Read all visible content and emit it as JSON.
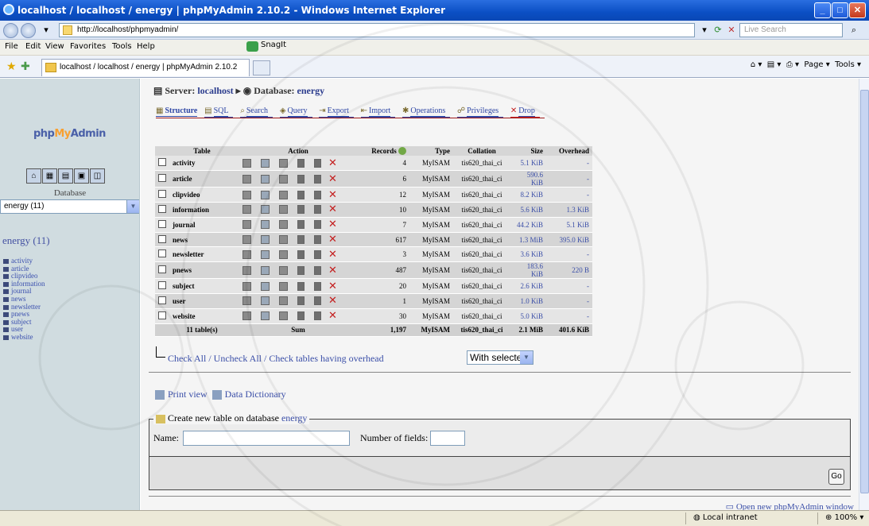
{
  "window": {
    "title": "localhost / localhost / energy | phpMyAdmin 2.10.2 - Windows Internet Explorer"
  },
  "browser": {
    "url": "http://localhost/phpmyadmin/",
    "search_placeholder": "Live Search",
    "menu": [
      "File",
      "Edit",
      "View",
      "Favorites",
      "Tools",
      "Help"
    ],
    "snagit": "SnagIt",
    "tab_title": "localhost / localhost / energy | phpMyAdmin 2.10.2",
    "cmd_page": "Page",
    "cmd_tools": "Tools"
  },
  "left": {
    "logo": {
      "a": "php",
      "b": "My",
      "c": "Admin"
    },
    "db_label": "Database",
    "db_selected": "energy (11)",
    "db_heading": "energy (11)",
    "tables": [
      "activity",
      "article",
      "clipvideo",
      "information",
      "journal",
      "news",
      "newsletter",
      "pnews",
      "subject",
      "user",
      "website"
    ]
  },
  "main": {
    "server_label": "Server:",
    "server_name": "localhost",
    "database_label": "Database:",
    "database_name": "energy",
    "tabs": [
      "Structure",
      "SQL",
      "Search",
      "Query",
      "Export",
      "Import",
      "Operations",
      "Privileges",
      "Drop"
    ],
    "columns": [
      "Table",
      "Action",
      "Records",
      "Type",
      "Collation",
      "Size",
      "Overhead"
    ],
    "rows": [
      {
        "name": "activity",
        "records": "4",
        "type": "MyISAM",
        "collation": "tis620_thai_ci",
        "size": "5.1 KiB",
        "overhead": "-"
      },
      {
        "name": "article",
        "records": "6",
        "type": "MyISAM",
        "collation": "tis620_thai_ci",
        "size": "590.6 KiB",
        "overhead": "-"
      },
      {
        "name": "clipvideo",
        "records": "12",
        "type": "MyISAM",
        "collation": "tis620_thai_ci",
        "size": "8.2 KiB",
        "overhead": "-"
      },
      {
        "name": "information",
        "records": "10",
        "type": "MyISAM",
        "collation": "tis620_thai_ci",
        "size": "5.6 KiB",
        "overhead": "1.3 KiB"
      },
      {
        "name": "journal",
        "records": "7",
        "type": "MyISAM",
        "collation": "tis620_thai_ci",
        "size": "44.2 KiB",
        "overhead": "5.1 KiB"
      },
      {
        "name": "news",
        "records": "617",
        "type": "MyISAM",
        "collation": "tis620_thai_ci",
        "size": "1.3 MiB",
        "overhead": "395.0 KiB"
      },
      {
        "name": "newsletter",
        "records": "3",
        "type": "MyISAM",
        "collation": "tis620_thai_ci",
        "size": "3.6 KiB",
        "overhead": "-"
      },
      {
        "name": "pnews",
        "records": "487",
        "type": "MyISAM",
        "collation": "tis620_thai_ci",
        "size": "183.6 KiB",
        "overhead": "220 B"
      },
      {
        "name": "subject",
        "records": "20",
        "type": "MyISAM",
        "collation": "tis620_thai_ci",
        "size": "2.6 KiB",
        "overhead": "-"
      },
      {
        "name": "user",
        "records": "1",
        "type": "MyISAM",
        "collation": "tis620_thai_ci",
        "size": "1.0 KiB",
        "overhead": "-"
      },
      {
        "name": "website",
        "records": "30",
        "type": "MyISAM",
        "collation": "tis620_thai_ci",
        "size": "5.0 KiB",
        "overhead": "-"
      }
    ],
    "summary": {
      "label": "11 table(s)",
      "sum": "Sum",
      "records": "1,197",
      "type": "MyISAM",
      "collation": "tis620_thai_ci",
      "size": "2.1 MiB",
      "overhead": "401.6 KiB"
    },
    "check_all": "Check All",
    "uncheck_all": "Uncheck All",
    "check_overhead": "Check tables having overhead",
    "with_selected": "With selected:",
    "print_view": "Print view",
    "data_dictionary": "Data Dictionary",
    "create_legend_prefix": "Create new table on database",
    "create_legend_db": "energy",
    "name_label": "Name:",
    "fields_label": "Number of fields:",
    "go_label": "Go",
    "open_new_window": "Open new phpMyAdmin window"
  },
  "status": {
    "zone": "Local intranet",
    "zoom": "100%"
  },
  "colors": {
    "titlebar": "#0b4fc4",
    "left_frame": "#d0dce0",
    "link": "#3b4fa8",
    "drop": "#c41e1e"
  }
}
